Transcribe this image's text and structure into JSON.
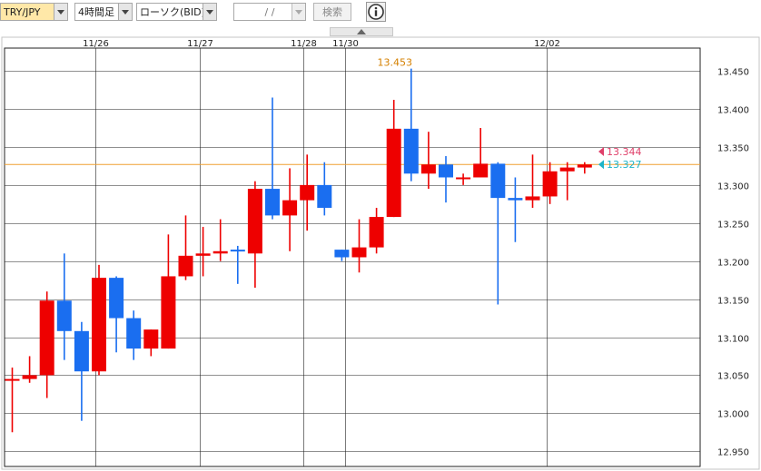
{
  "toolbar": {
    "pair": "TRY/JPY",
    "timeframe": "4時間足",
    "chart_style": "ローソク(BID)",
    "date_input": " /  / ",
    "search_label": "検索",
    "info_icon": "info-icon"
  },
  "colors": {
    "up": "#ee0000",
    "down": "#1a6ef0",
    "line": "#f0a030",
    "bid_tag": "#e0406a",
    "ask_tag": "#1cb4c8"
  },
  "chart_data": {
    "type": "candlestick",
    "ylim": [
      12.93,
      13.48
    ],
    "y_ticks": [
      12.95,
      13.0,
      13.05,
      13.1,
      13.15,
      13.2,
      13.25,
      13.3,
      13.35,
      13.4,
      13.45
    ],
    "y_tick_labels": [
      "12.950",
      "13.000",
      "13.050",
      "13.100",
      "13.150",
      "13.200",
      "13.250",
      "13.300",
      "13.350",
      "13.400",
      "13.450"
    ],
    "x_labels": [
      {
        "label": "11/26",
        "index": 4.8
      },
      {
        "label": "11/27",
        "index": 10.8
      },
      {
        "label": "11/28",
        "index": 16.8
      },
      {
        "label": "11/30",
        "index": 19.2
      },
      {
        "label": "12/02",
        "index": 30.8
      }
    ],
    "candles": [
      {
        "o": 13.045,
        "h": 13.06,
        "l": 12.975,
        "c": 13.045
      },
      {
        "o": 13.045,
        "h": 13.075,
        "l": 13.04,
        "c": 13.05
      },
      {
        "o": 13.05,
        "h": 13.16,
        "l": 13.02,
        "c": 13.148
      },
      {
        "o": 13.148,
        "h": 13.21,
        "l": 13.07,
        "c": 13.108
      },
      {
        "o": 13.108,
        "h": 13.12,
        "l": 12.99,
        "c": 13.055
      },
      {
        "o": 13.055,
        "h": 13.195,
        "l": 13.05,
        "c": 13.178
      },
      {
        "o": 13.178,
        "h": 13.18,
        "l": 13.08,
        "c": 13.125
      },
      {
        "o": 13.125,
        "h": 13.135,
        "l": 13.07,
        "c": 13.085
      },
      {
        "o": 13.085,
        "h": 13.11,
        "l": 13.075,
        "c": 13.11
      },
      {
        "o": 13.085,
        "h": 13.235,
        "l": 13.085,
        "c": 13.18
      },
      {
        "o": 13.18,
        "h": 13.26,
        "l": 13.175,
        "c": 13.207
      },
      {
        "o": 13.207,
        "h": 13.245,
        "l": 13.18,
        "c": 13.21
      },
      {
        "o": 13.21,
        "h": 13.255,
        "l": 13.2,
        "c": 13.213
      },
      {
        "o": 13.215,
        "h": 13.22,
        "l": 13.17,
        "c": 13.213
      },
      {
        "o": 13.21,
        "h": 13.305,
        "l": 13.165,
        "c": 13.295
      },
      {
        "o": 13.295,
        "h": 13.415,
        "l": 13.255,
        "c": 13.26
      },
      {
        "o": 13.26,
        "h": 13.322,
        "l": 13.213,
        "c": 13.28
      },
      {
        "o": 13.28,
        "h": 13.34,
        "l": 13.24,
        "c": 13.3
      },
      {
        "o": 13.3,
        "h": 13.33,
        "l": 13.26,
        "c": 13.27
      },
      {
        "o": 13.215,
        "h": 13.215,
        "l": 13.2,
        "c": 13.205
      },
      {
        "o": 13.205,
        "h": 13.255,
        "l": 13.185,
        "c": 13.218
      },
      {
        "o": 13.218,
        "h": 13.27,
        "l": 13.21,
        "c": 13.258
      },
      {
        "o": 13.258,
        "h": 13.412,
        "l": 13.258,
        "c": 13.374
      },
      {
        "o": 13.374,
        "h": 13.453,
        "l": 13.305,
        "c": 13.315
      },
      {
        "o": 13.315,
        "h": 13.37,
        "l": 13.295,
        "c": 13.327
      },
      {
        "o": 13.327,
        "h": 13.338,
        "l": 13.277,
        "c": 13.31
      },
      {
        "o": 13.31,
        "h": 13.315,
        "l": 13.3,
        "c": 13.31
      },
      {
        "o": 13.31,
        "h": 13.375,
        "l": 13.31,
        "c": 13.328
      },
      {
        "o": 13.328,
        "h": 13.33,
        "l": 13.143,
        "c": 13.283
      },
      {
        "o": 13.283,
        "h": 13.31,
        "l": 13.225,
        "c": 13.28
      },
      {
        "o": 13.28,
        "h": 13.34,
        "l": 13.27,
        "c": 13.285
      },
      {
        "o": 13.285,
        "h": 13.33,
        "l": 13.275,
        "c": 13.318
      },
      {
        "o": 13.318,
        "h": 13.33,
        "l": 13.28,
        "c": 13.323
      },
      {
        "o": 13.323,
        "h": 13.33,
        "l": 13.315,
        "c": 13.327
      }
    ],
    "annotations": {
      "high_label": "13.453",
      "high_value": 13.453,
      "high_index": 23,
      "bid_label": "13.344",
      "bid_value": 13.344,
      "ask_label": "13.327",
      "ask_value": 13.327,
      "hline_value": 13.327
    }
  }
}
